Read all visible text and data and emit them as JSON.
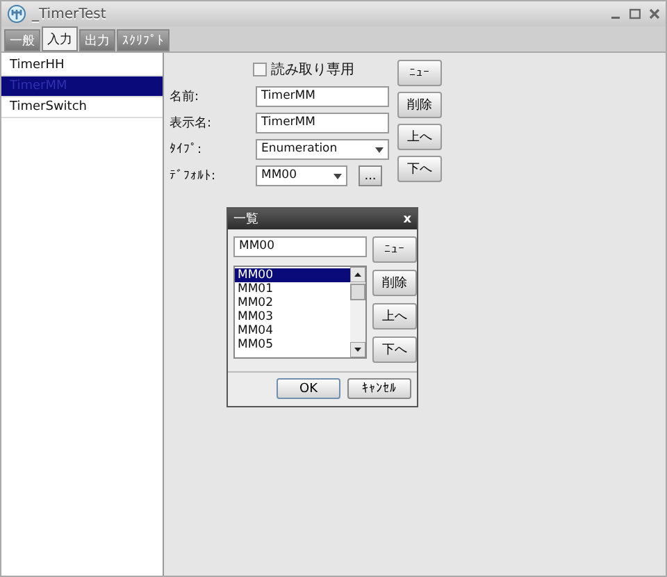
{
  "window": {
    "title": "_TimerTest"
  },
  "tabs": [
    {
      "label": "一般",
      "selected": false
    },
    {
      "label": "入力",
      "selected": true
    },
    {
      "label": "出力",
      "selected": false
    },
    {
      "label": "ｽｸﾘﾌﾟﾄ",
      "selected": false
    }
  ],
  "list": [
    {
      "label": "TimerHH",
      "selected": false
    },
    {
      "label": "TimerMM",
      "selected": true
    },
    {
      "label": "TimerSwitch",
      "selected": false
    }
  ],
  "readonly": {
    "label": "読み取り専用",
    "checked": false
  },
  "fields": [
    {
      "label": "名前:",
      "kind": "text",
      "value": "TimerMM"
    },
    {
      "label": "表示名:",
      "kind": "text",
      "value": "TimerMM"
    },
    {
      "label": "ﾀｲﾌﾟ:",
      "kind": "combo",
      "value": "Enumeration"
    },
    {
      "label": "ﾃﾞﾌｫﾙﾄ:",
      "kind": "combo-more",
      "value": "MM00",
      "more": "..."
    }
  ],
  "buttons": [
    "ﾆｭｰ",
    "削除",
    "上へ",
    "下へ"
  ],
  "dialog": {
    "title": "一覧",
    "close": "x",
    "value": "MM00",
    "items": [
      {
        "label": "MM00",
        "selected": true
      },
      {
        "label": "MM01",
        "selected": false
      },
      {
        "label": "MM02",
        "selected": false
      },
      {
        "label": "MM03",
        "selected": false
      },
      {
        "label": "MM04",
        "selected": false
      },
      {
        "label": "MM05",
        "selected": false
      }
    ],
    "buttons": [
      "ﾆｭｰ",
      "削除",
      "上へ",
      "下へ"
    ],
    "ok": "OK",
    "cancel": "ｷｬﾝｾﾙ"
  }
}
